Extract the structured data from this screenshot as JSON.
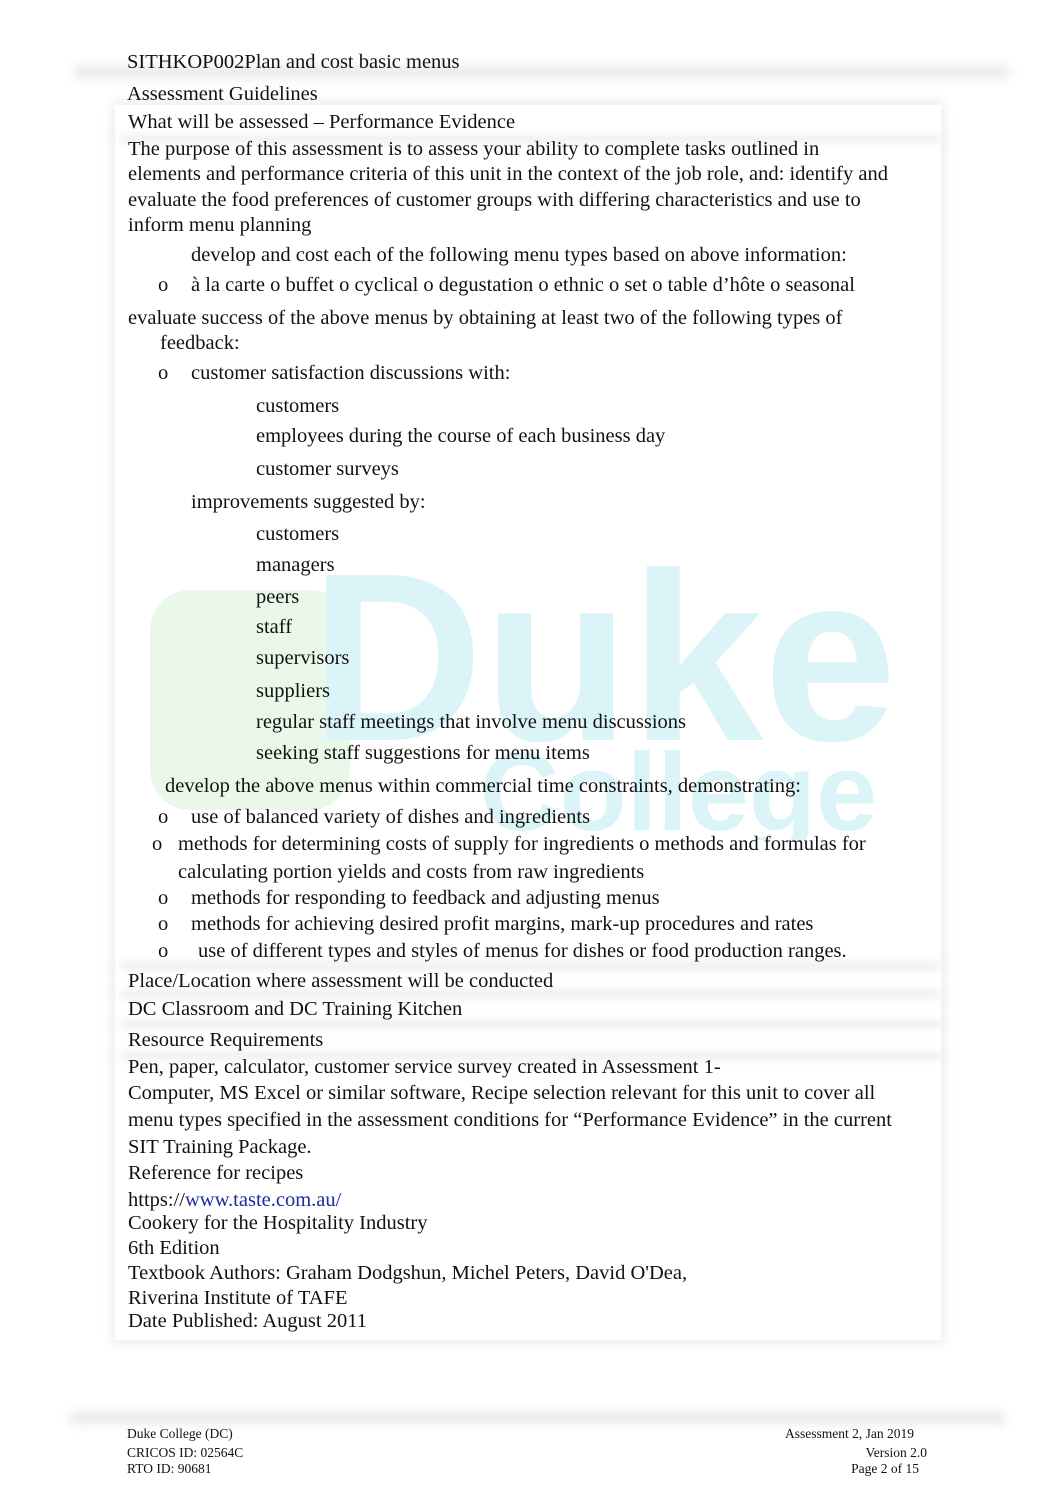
{
  "header": {
    "unit": "SITHKOP002Plan and cost basic menus"
  },
  "watermark": {
    "text": "Duke College",
    "color": "#22c0d8"
  },
  "section_title": "Assessment Guidelines",
  "what_heading": "What will be assessed – Performance Evidence",
  "purpose_lines": [
    "The purpose of this assessment is to assess your ability to complete tasks outlined in",
    "elements and performance criteria of this unit in the context of the job role, and: identify and",
    "evaluate the food preferences of customer groups with differing characteristics and use to",
    "inform menu planning"
  ],
  "bullet_glyph": "",
  "sub_glyph": "o",
  "develop_cost": "develop and cost each of the following menu types based on above information:",
  "menu_types": "à la carte o buffet o cyclical o degustation o ethnic o set o table d’hôte o seasonal",
  "evaluate_lines": [
    "evaluate success of the above menus by obtaining at least two of the following types of",
    "feedback:"
  ],
  "customer_satisfaction": "customer satisfaction discussions with:",
  "cs_items": [
    "customers",
    "employees during the course of each business day",
    "customer surveys"
  ],
  "improvements": "improvements suggested by:",
  "imp_items": [
    "customers",
    "managers",
    "peers",
    "staff",
    "supervisors",
    "suppliers",
    "regular staff meetings that involve menu discussions",
    "seeking staff suggestions for menu items"
  ],
  "develop_time": "develop the above menus within commercial time constraints, demonstrating:",
  "dt_items": [
    "use of balanced variety of dishes and ingredients",
    "methods for determining costs of supply for ingredients o methods and formulas for",
    "calculating portion yields and costs from raw ingredients",
    "methods for responding to feedback and adjusting menus",
    "methods for achieving desired profit margins, mark-up procedures and rates",
    "use of different types and styles of menus for dishes or food production ranges."
  ],
  "place_heading": "Place/Location where assessment will be conducted",
  "place_value": "DC Classroom and DC Training Kitchen",
  "resource_heading": "Resource Requirements",
  "resource_lines": [
    "Pen, paper, calculator, customer service survey created in Assessment 1-",
    "Computer, MS Excel or similar software, Recipe selection relevant for this unit to cover all",
    "menu types specified in the assessment conditions for “Performance Evidence” in the current",
    "SIT Training Package.",
    "Reference for recipes"
  ],
  "link_prefix": "https://",
  "link_text": "www.taste.com.au/",
  "book_lines": [
    "Cookery for the Hospitality Industry",
    "6th Edition",
    "Textbook Authors: Graham Dodgshun, Michel Peters, David O'Dea,",
    "Riverina Institute of TAFE",
    "Date Published: August 2011"
  ],
  "footer": {
    "left": [
      "Duke College (DC)",
      "CRICOS ID: 02564C",
      "RTO ID: 90681"
    ],
    "right": [
      "Assessment 2, Jan 2019",
      "Version 2.0",
      "Page 2 of 15"
    ]
  }
}
